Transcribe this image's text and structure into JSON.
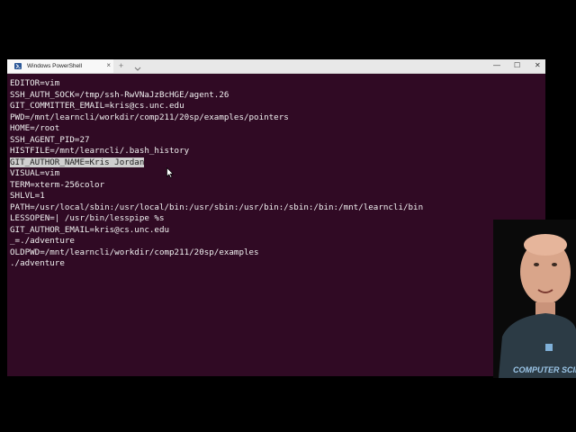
{
  "window": {
    "tab_title": "Windows PowerShell",
    "tab_close": "×",
    "new_tab": "+",
    "minimize": "—",
    "maximize": "☐",
    "close": "✕"
  },
  "terminal": {
    "lines": [
      "EDITOR=vim",
      "SSH_AUTH_SOCK=/tmp/ssh-RwVNaJzBcHGE/agent.26",
      "GIT_COMMITTER_EMAIL=kris@cs.unc.edu",
      "PWD=/mnt/learncli/workdir/comp211/20sp/examples/pointers",
      "HOME=/root",
      "SSH_AGENT_PID=27",
      "HISTFILE=/mnt/learncli/.bash_history",
      "GIT_AUTHOR_NAME=Kris Jordan",
      "VISUAL=vim",
      "TERM=xterm-256color",
      "SHLVL=1",
      "PATH=/usr/local/sbin:/usr/local/bin:/usr/sbin:/usr/bin:/sbin:/bin:/mnt/learncli/bin",
      "LESSOPEN=| /usr/bin/lesspipe %s",
      "GIT_AUTHOR_EMAIL=kris@cs.unc.edu",
      "_=./adventure",
      "OLDPWD=/mnt/learncli/workdir/comp211/20sp/examples",
      "./adventure"
    ],
    "selected_line_index": 7
  },
  "webcam": {
    "shirt_text": "COMPUTER SCIE"
  },
  "colors": {
    "terminal_bg": "#300a24",
    "terminal_fg": "#f0f0f0",
    "selection_bg": "#cfcfcf",
    "titlebar_bg": "#e8e8e8"
  }
}
